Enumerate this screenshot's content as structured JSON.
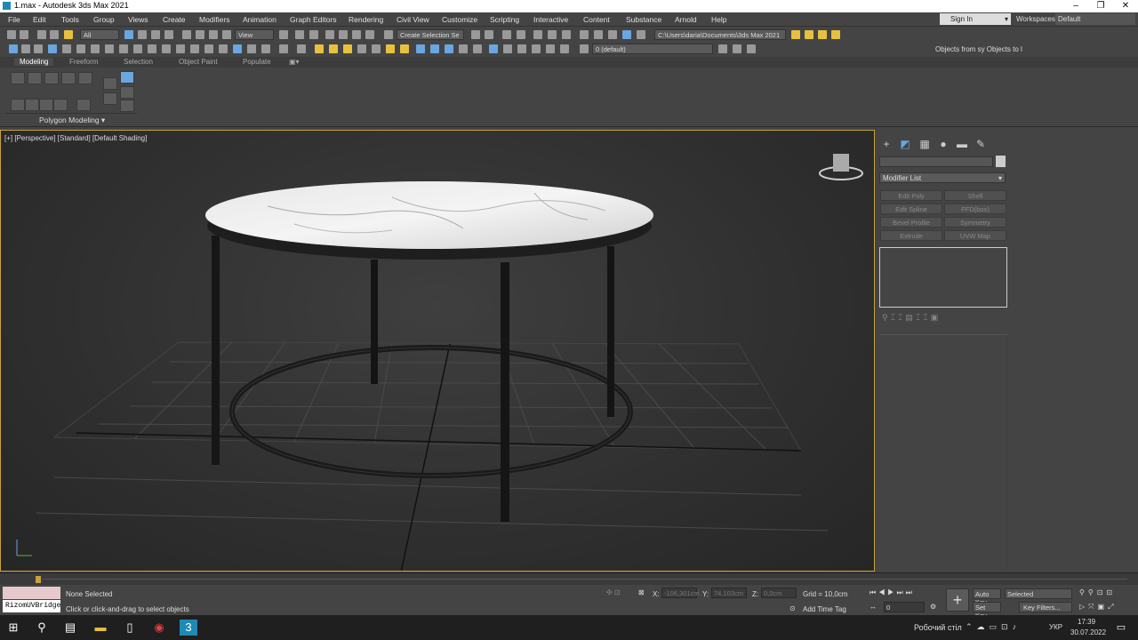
{
  "window": {
    "title": "1.max - Autodesk 3ds Max 2021"
  },
  "menu": {
    "items": [
      "File",
      "Edit",
      "Tools",
      "Group",
      "Views",
      "Create",
      "Modifiers",
      "Animation",
      "Graph Editors",
      "Rendering",
      "Civil View",
      "Customize",
      "Scripting",
      "Interactive",
      "Content",
      "Substance",
      "Arnold",
      "Help"
    ],
    "sign_in": "Sign In",
    "workspaces_label": "Workspaces:",
    "workspaces_value": "Default"
  },
  "toolbar1": {
    "filter": "All",
    "view": "View",
    "create_selection_set": "Create Selection Se",
    "project_path": "C:\\Users\\daria\\Documents\\3ds Max 2021"
  },
  "toolbar2": {
    "layer": "0 (default)",
    "objects_from": "Objects from sy Objects to l"
  },
  "ribbon": {
    "tabs": [
      "Modeling",
      "Freeform",
      "Selection",
      "Object Paint",
      "Populate"
    ],
    "panel_label": "Polygon Modeling ▾"
  },
  "viewport": {
    "label": "[+] [Perspective] [Standard] [Default Shading]"
  },
  "command_panel": {
    "modifier_list": "Modifier List",
    "modifier_buttons": [
      "Edit Poly",
      "Shell",
      "Edit Spline",
      "FFD(box)",
      "Bevel Profile",
      "Symmetry",
      "Extrude",
      "UVW Map"
    ]
  },
  "status": {
    "maxscript": "RizomUVBridge",
    "selection": "None Selected",
    "prompt": "Click or click-and-drag to select objects",
    "x_label": "X:",
    "x_value": "-106,301cm",
    "y_label": "Y:",
    "y_value": "74,103cm",
    "z_label": "Z:",
    "z_value": "0,0cm",
    "grid": "Grid = 10,0cm",
    "add_time_tag": "Add Time Tag",
    "auto_key": "Auto Key",
    "set_key": "Set Key",
    "selected": "Selected",
    "key_filters": "Key Filters...",
    "frame": "0"
  },
  "taskbar": {
    "desktop_label": "Робочий стіл",
    "language": "УКР",
    "time": "17:39",
    "date": "30.07.2022"
  }
}
